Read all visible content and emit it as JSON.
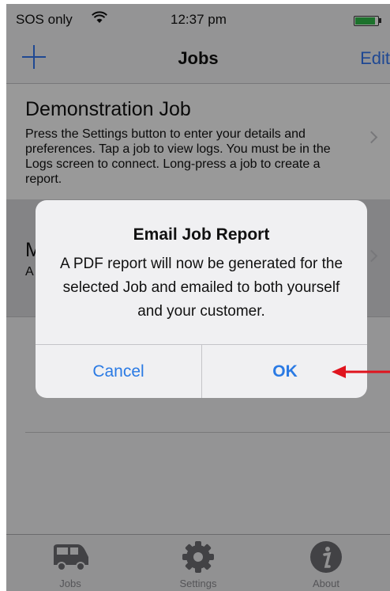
{
  "status_bar": {
    "carrier": "SOS only",
    "wifi_icon": "wifi-icon",
    "time": "12:37 pm",
    "battery_level": 0.9,
    "battery_color": "#2fbf4a"
  },
  "nav": {
    "add_icon": "plus-icon",
    "title": "Jobs",
    "edit_label": "Edit"
  },
  "jobs": [
    {
      "title": "Demonstration Job",
      "description": "Press the Settings button to enter your details and preferences. Tap a job to view logs. You must be in the Logs screen to connect. Long-press a job to create a report."
    },
    {
      "title": "M",
      "description": "A"
    }
  ],
  "tabs": [
    {
      "label": "Jobs",
      "icon": "van-icon"
    },
    {
      "label": "Settings",
      "icon": "gear-icon"
    },
    {
      "label": "About",
      "icon": "info-icon"
    }
  ],
  "alert": {
    "title": "Email Job Report",
    "message": "A PDF report will now be generated for the selected Job and emailed to both yourself and your customer.",
    "cancel_label": "Cancel",
    "ok_label": "OK"
  },
  "annotation": {
    "arrow_color": "#e0141e",
    "icon": "arrow-left-icon"
  },
  "colors": {
    "accent": "#3478f6",
    "alert_button": "#2a7ae4",
    "tab_inactive": "#8e8e93"
  }
}
